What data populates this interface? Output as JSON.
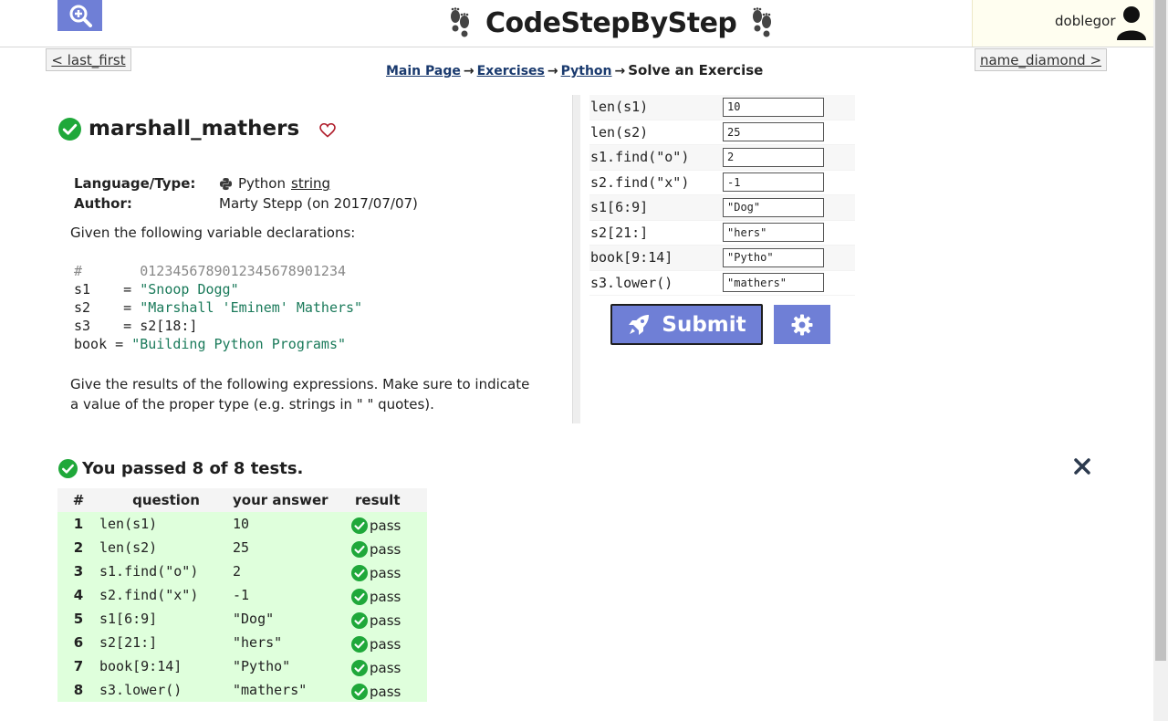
{
  "header": {
    "site_title": "CodeStepByStep",
    "username": "doblegor",
    "accent": "#6f7fd6"
  },
  "nav": {
    "prev_label": "< last_first",
    "next_label": "name_diamond >",
    "breadcrumb": [
      "Main Page",
      "Exercises",
      "Python"
    ],
    "breadcrumb_current": "Solve an Exercise"
  },
  "problem": {
    "title": "marshall_mathers",
    "language_label": "Language/Type:",
    "language": "Python",
    "language_type": "string",
    "author_label": "Author:",
    "author": "Marty Stepp (on 2017/07/07)",
    "description1": "Given the following variable declarations:",
    "code": {
      "comment_hash": "#",
      "comment_digits": "0123456789012345678901234",
      "lines": [
        {
          "var": "s1",
          "eq": " = ",
          "val": "\"Snoop Dogg\"",
          "kind": "str"
        },
        {
          "var": "s2",
          "eq": " = ",
          "val": "\"Marshall 'Eminem' Mathers\"",
          "kind": "str"
        },
        {
          "var": "s3",
          "eq": " = ",
          "val": "s2[18:]",
          "kind": "plain"
        },
        {
          "var": "book",
          "eq": " = ",
          "val": "\"Building Python Programs\"",
          "kind": "str"
        }
      ]
    },
    "description2": "Give the results of the following expressions. Make sure to indicate a value of the proper type (e.g. strings in \"  \" quotes)."
  },
  "answers": [
    {
      "question": "len(s1)",
      "value": "10"
    },
    {
      "question": "len(s2)",
      "value": "25"
    },
    {
      "question": "s1.find(\"o\")",
      "value": "2"
    },
    {
      "question": "s2.find(\"x\")",
      "value": "-1"
    },
    {
      "question": "s1[6:9]",
      "value": "\"Dog\""
    },
    {
      "question": "s2[21:]",
      "value": "\"hers\""
    },
    {
      "question": "book[9:14]",
      "value": "\"Pytho\""
    },
    {
      "question": "s3.lower()",
      "value": "\"mathers\""
    }
  ],
  "submit_label": "Submit",
  "results": {
    "summary": "You passed 8 of 8 tests.",
    "headers": [
      "#",
      "question",
      "your answer",
      "result"
    ],
    "pass_label": "pass",
    "rows": [
      {
        "num": "1",
        "question": "len(s1)",
        "answer": "10",
        "result": "pass"
      },
      {
        "num": "2",
        "question": "len(s2)",
        "answer": "25",
        "result": "pass"
      },
      {
        "num": "3",
        "question": "s1.find(\"o\")",
        "answer": "2",
        "result": "pass"
      },
      {
        "num": "4",
        "question": "s2.find(\"x\")",
        "answer": "-1",
        "result": "pass"
      },
      {
        "num": "5",
        "question": "s1[6:9]",
        "answer": "\"Dog\"",
        "result": "pass"
      },
      {
        "num": "6",
        "question": "s2[21:]",
        "answer": "\"hers\"",
        "result": "pass"
      },
      {
        "num": "7",
        "question": "book[9:14]",
        "answer": "\"Pytho\"",
        "result": "pass"
      },
      {
        "num": "8",
        "question": "s3.lower()",
        "answer": "\"mathers\"",
        "result": "pass"
      }
    ]
  },
  "colors": {
    "pass_green": "#1fa83a",
    "pass_row_bg": "#dfffdc",
    "link": "#1a3a6e"
  }
}
